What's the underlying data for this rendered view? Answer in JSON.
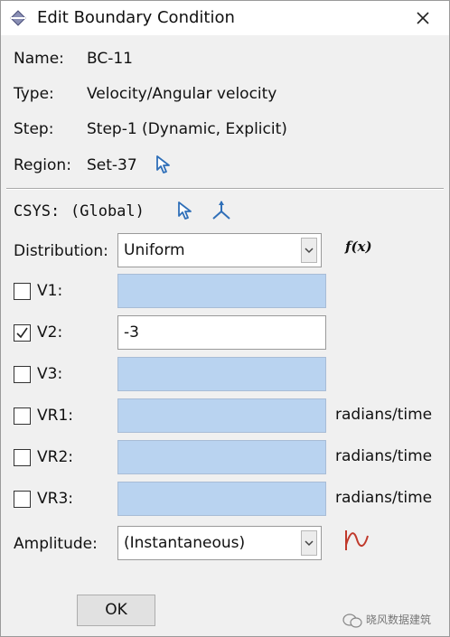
{
  "dialog": {
    "title": "Edit Boundary Condition",
    "close_glyph": "✕"
  },
  "info": {
    "name_label": "Name:",
    "name_value": "BC-11",
    "type_label": "Type:",
    "type_value": "Velocity/Angular velocity",
    "step_label": "Step:",
    "step_value": "Step-1 (Dynamic, Explicit)",
    "region_label": "Region:",
    "region_value": "Set-37"
  },
  "csys": {
    "label": "CSYS:",
    "value": "(Global)"
  },
  "distribution": {
    "label": "Distribution:",
    "selected": "Uniform",
    "fx_label": "f(x)"
  },
  "components": [
    {
      "label": "V1:",
      "checked": false,
      "value": "",
      "unit": ""
    },
    {
      "label": "V2:",
      "checked": true,
      "value": "-3",
      "unit": ""
    },
    {
      "label": "V3:",
      "checked": false,
      "value": "",
      "unit": ""
    },
    {
      "label": "VR1:",
      "checked": false,
      "value": "",
      "unit": "radians/time"
    },
    {
      "label": "VR2:",
      "checked": false,
      "value": "",
      "unit": "radians/time"
    },
    {
      "label": "VR3:",
      "checked": false,
      "value": "",
      "unit": "radians/time"
    }
  ],
  "amplitude": {
    "label": "Amplitude:",
    "selected": "(Instantaneous)"
  },
  "buttons": {
    "ok": "OK"
  },
  "watermark": {
    "text": "晓风数据建筑"
  },
  "colors": {
    "disabled_field": "#b9d3f0",
    "icon_blue": "#2f6fb8",
    "amplitude_icon": "#c0392b"
  },
  "icons": {
    "title": "abaqus-diamond-icon",
    "region_select": "select-arrow-icon",
    "csys_select": "select-arrow-icon",
    "csys_axes": "csys-axes-icon",
    "amplitude_create": "amplitude-wave-icon"
  }
}
